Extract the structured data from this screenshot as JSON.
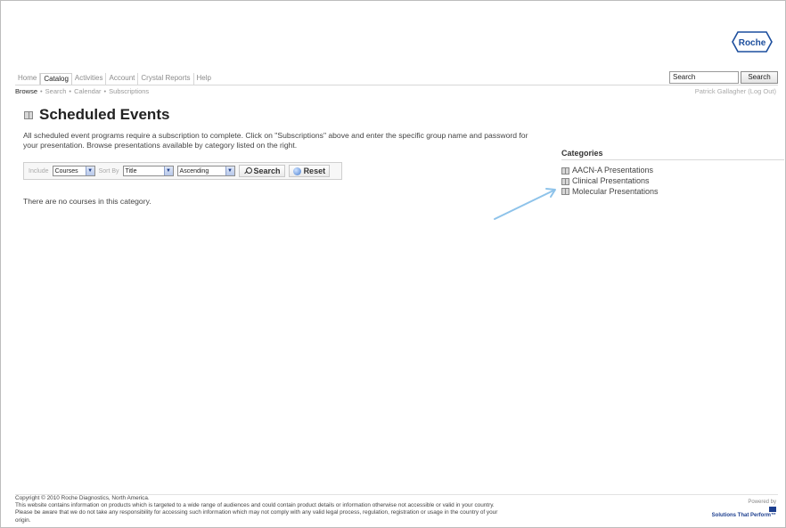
{
  "logo": {
    "text": "Roche",
    "color": "#1c4e9d"
  },
  "nav": {
    "tabs": [
      "Home",
      "Catalog",
      "Activities",
      "Account",
      "Crystal Reports",
      "Help"
    ],
    "active_index": 1
  },
  "search": {
    "value": "Search",
    "button_label": "Search"
  },
  "subnav": {
    "items": [
      "Browse",
      "Search",
      "Calendar",
      "Subscriptions"
    ],
    "separator": "•"
  },
  "user": {
    "text": "Patrick Gallagher (Log Out)"
  },
  "page": {
    "title": "Scheduled Events",
    "intro": "All scheduled event programs require a subscription to complete. Click on \"Subscriptions\" above and enter the specific group name and password for your presentation. Browse presentations available by category listed on the right."
  },
  "filters": {
    "include_label": "Include",
    "include_value": "Courses",
    "sort_label": "Sort By",
    "sort_value": "Title",
    "order_value": "Ascending",
    "search_label": "Search",
    "reset_label": "Reset"
  },
  "empty_message": "There are no courses in this category.",
  "categories": {
    "title": "Categories",
    "items": [
      "AACN-A Presentations",
      "Clinical Presentations",
      "Molecular Presentations"
    ]
  },
  "annotation_arrow": {
    "color": "#8ec3ea"
  },
  "footer": {
    "lines": [
      "Copyright © 2010 Roche Diagnostics, North America.",
      "This website contains information on products which is targeted to a wide range of audiences and could contain product details or information otherwise not accessible or valid in your country.",
      "Please be aware that we do not take any responsibility for accessing such information which may not comply with any valid legal process, regulation, registration or usage in the country of your",
      "origin."
    ]
  },
  "powered": {
    "label": "Powered by",
    "tagline": "Solutions That Perform™"
  }
}
